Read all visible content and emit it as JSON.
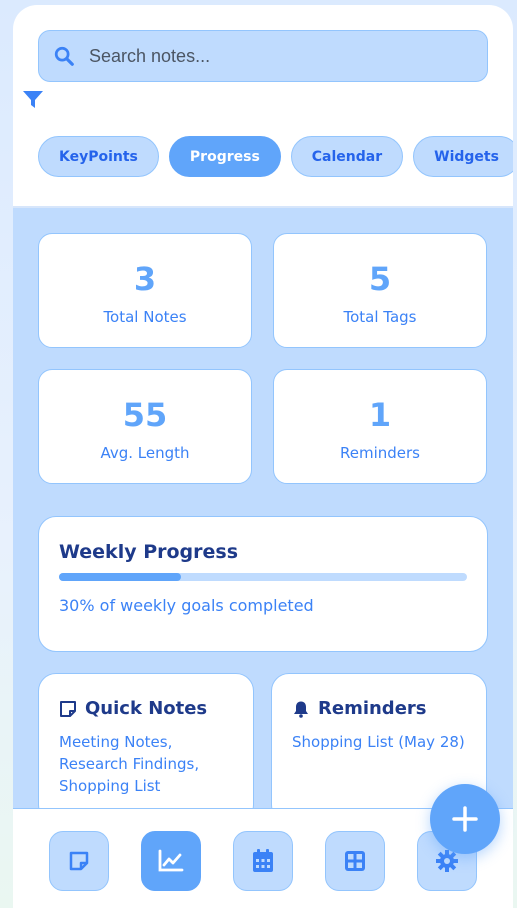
{
  "search": {
    "placeholder": "Search notes...",
    "value": ""
  },
  "tabs": [
    {
      "label": "KeyPoints",
      "active": false
    },
    {
      "label": "Progress",
      "active": true
    },
    {
      "label": "Calendar",
      "active": false
    },
    {
      "label": "Widgets",
      "active": false
    }
  ],
  "stats": [
    {
      "value": "3",
      "label": "Total Notes"
    },
    {
      "value": "5",
      "label": "Total Tags"
    },
    {
      "value": "55",
      "label": "Avg. Length"
    },
    {
      "value": "1",
      "label": "Reminders"
    }
  ],
  "weekly": {
    "title": "Weekly Progress",
    "progress": 0.3,
    "caption": "30% of weekly goals completed"
  },
  "quick_notes": {
    "title": "Quick Notes",
    "items": [
      "Meeting Notes,",
      "Research Findings,",
      "Shopping List"
    ]
  },
  "reminders": {
    "title": "Reminders",
    "items": [
      "Shopping List (May 28)"
    ]
  },
  "nav": [
    {
      "icon": "note-icon",
      "active": false
    },
    {
      "icon": "chart-icon",
      "active": true
    },
    {
      "icon": "calendar-icon",
      "active": false
    },
    {
      "icon": "grid-icon",
      "active": false
    },
    {
      "icon": "gear-icon",
      "active": false
    }
  ],
  "fab": {
    "icon": "plus-icon"
  },
  "colors": {
    "accent": "#60a5fa",
    "light": "#bfdbfe",
    "border": "#93c5fd",
    "text_dark": "#1e3a8a",
    "text_blue": "#3b82f6"
  }
}
